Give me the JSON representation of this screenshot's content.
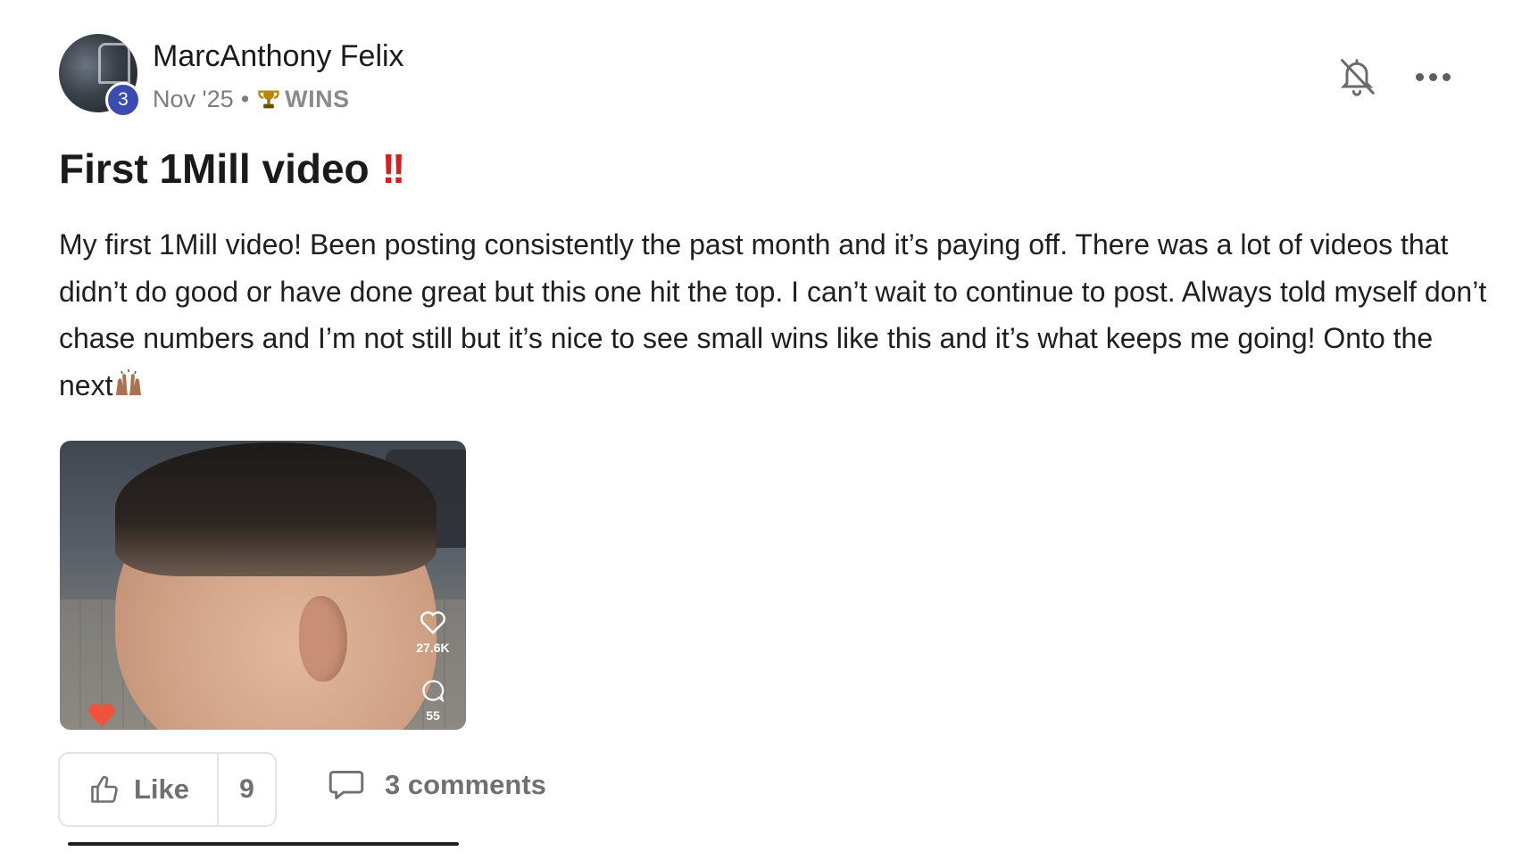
{
  "post": {
    "author": {
      "name": "MarcAnthony Felix",
      "level": "3"
    },
    "meta": {
      "date": "Nov '25",
      "separator": "•",
      "category": "WINS"
    },
    "title": "First 1Mill video",
    "title_emoji": "!!",
    "body": "My first 1Mill video! Been posting consistently the past month and it’s paying off. There was a lot of videos that didn’t do good or have done great but this one hit the top. I can’t wait to continue to post. Always told myself don’t chase numbers and I’m not still but it’s nice to see small wins like this and it’s what keeps me going! Onto the next",
    "media": {
      "likes": "27.6K",
      "comments": "55"
    },
    "actions": {
      "like_label": "Like",
      "like_count": "9",
      "comments_label": "3 comments"
    }
  },
  "icons": {
    "bell": "bell-off-icon",
    "more": "more-horizontal-icon",
    "trophy": "trophy-icon",
    "like": "thumbs-up-icon",
    "comment": "comment-icon",
    "hands": "raising-hands-emoji"
  },
  "colors": {
    "badge": "#3a4cb0",
    "muted_text": "#707070",
    "title_emoji": "#d81e1e"
  }
}
